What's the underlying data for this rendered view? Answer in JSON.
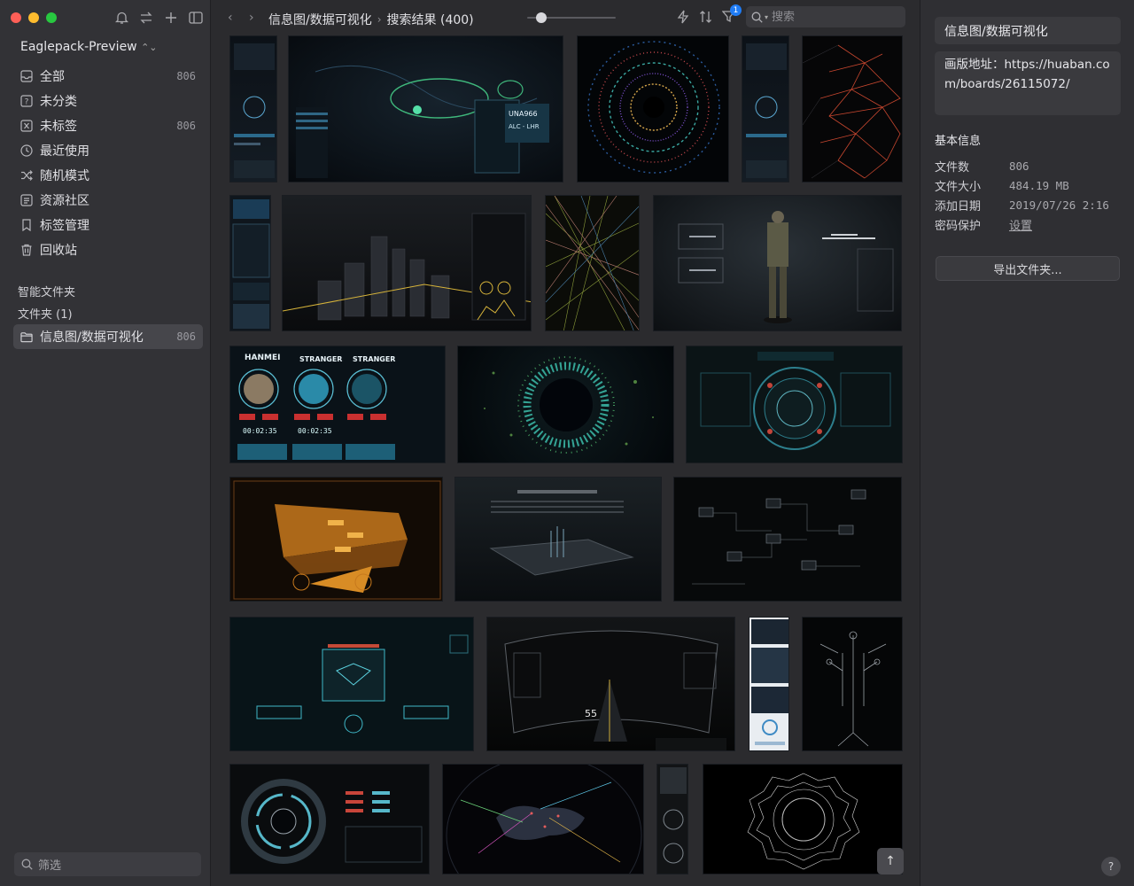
{
  "library": {
    "name": "Eaglepack-Preview"
  },
  "sidebar": {
    "items": [
      {
        "label": "全部",
        "count": "806",
        "icon": "inbox-icon"
      },
      {
        "label": "未分类",
        "count": "",
        "icon": "unsorted-icon"
      },
      {
        "label": "未标签",
        "count": "806",
        "icon": "untagged-icon"
      },
      {
        "label": "最近使用",
        "count": "",
        "icon": "clock-icon"
      },
      {
        "label": "随机模式",
        "count": "",
        "icon": "shuffle-icon"
      },
      {
        "label": "资源社区",
        "count": "",
        "icon": "community-icon"
      },
      {
        "label": "标签管理",
        "count": "",
        "icon": "tag-icon"
      },
      {
        "label": "回收站",
        "count": "",
        "icon": "trash-icon"
      }
    ],
    "smart_folders_label": "智能文件夹",
    "folders_label": "文件夹 (1)",
    "folder": {
      "label": "信息图/数据可视化",
      "count": "806"
    },
    "filter_placeholder": "筛选"
  },
  "topbar": {
    "breadcrumb": [
      "信息图/数据可视化",
      "搜索结果 (400)"
    ],
    "filter_badge": "1",
    "search_placeholder": "搜索"
  },
  "inspector": {
    "title": "信息图/数据可视化",
    "note": "画版地址：https://huaban.com/boards/26115072/",
    "section": "基本信息",
    "info": [
      {
        "key": "文件数",
        "value": "806"
      },
      {
        "key": "文件大小",
        "value": "484.19 MB"
      },
      {
        "key": "添加日期",
        "value": "2019/07/26 2:16"
      },
      {
        "key": "密码保护",
        "value": "设置"
      }
    ],
    "export_label": "导出文件夹...",
    "help": "?"
  },
  "thumbnail_captions": {
    "hud_row3_names": [
      "HANMEI",
      "STRANGER",
      "STRANGER"
    ],
    "hud_row3_times": [
      "00:02:35",
      "00:02:35"
    ],
    "speed_value": "55",
    "car_chip": "UNA966",
    "car_chip2": "ALC - LHR"
  },
  "colors": {
    "accent": "#1f7cf5",
    "sidebar_bg": "#323236",
    "gallery_bg": "#2b2b2e"
  }
}
